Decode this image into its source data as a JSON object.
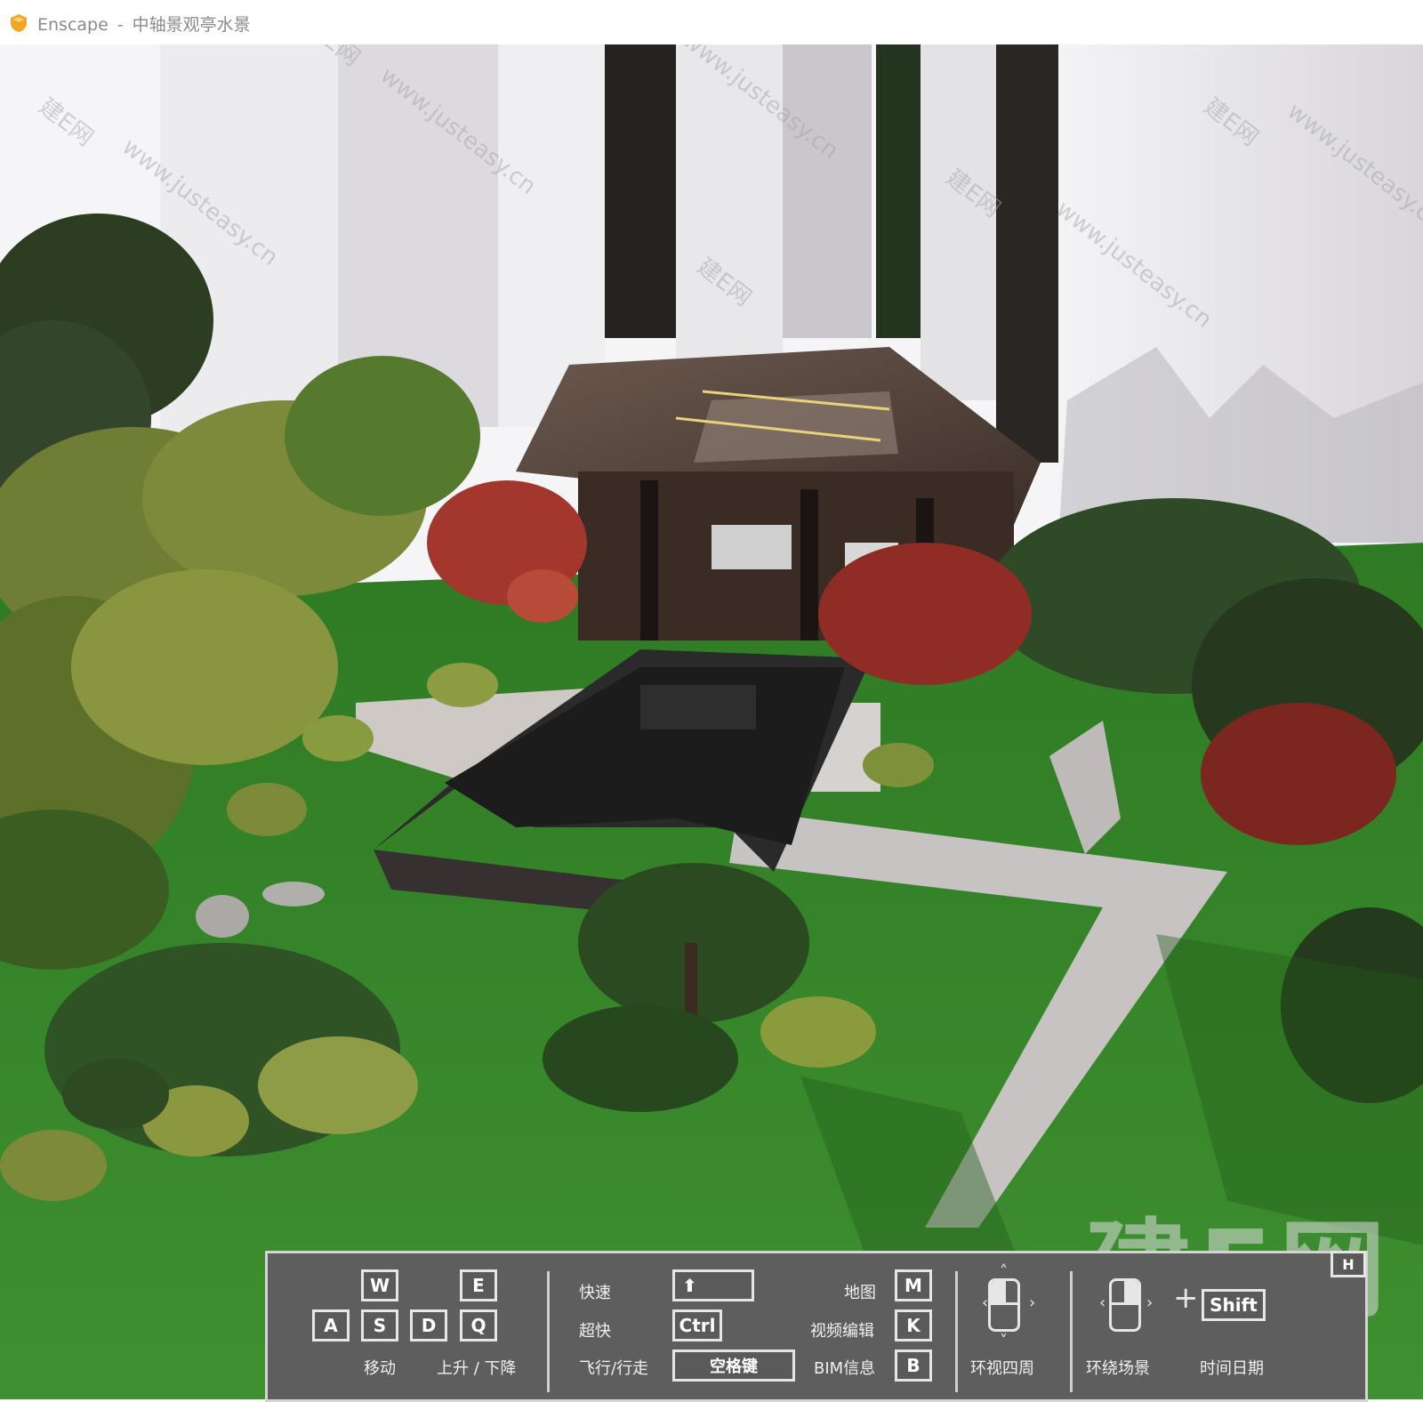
{
  "window": {
    "app_name": "Enscape",
    "separator": "-",
    "project_title": "中轴景观亭水景"
  },
  "watermark": {
    "url": "www.justeasy.cn",
    "brand": "建E网",
    "big_logo": "建E网"
  },
  "help_overlay": {
    "toggle_key": "H",
    "move": {
      "keys": [
        "W",
        "A",
        "S",
        "D"
      ],
      "label": "移动"
    },
    "updown": {
      "keys": [
        "E",
        "Q"
      ],
      "label": "上升 / 下降"
    },
    "speed": [
      {
        "label": "快速",
        "key": "⬆"
      },
      {
        "label": "超快",
        "key": "Ctrl"
      },
      {
        "label": "飞行/行走",
        "key": "空格键"
      }
    ],
    "shortcuts": [
      {
        "label": "地图",
        "key": "M"
      },
      {
        "label": "视频编辑",
        "key": "K"
      },
      {
        "label": "BIM信息",
        "key": "B"
      }
    ],
    "mouse_look": {
      "label": "环视四周"
    },
    "mouse_orbit": {
      "label": "环绕场景"
    },
    "time_of_day": {
      "key": "Shift",
      "label": "时间日期",
      "plus": "+"
    }
  },
  "colors": {
    "icon_orange": "#f2a623",
    "overlay_bg": "#5e5e5e",
    "grass": "#3f8f2e",
    "water": "#1e1e1e",
    "building": "#e9e8ea"
  }
}
